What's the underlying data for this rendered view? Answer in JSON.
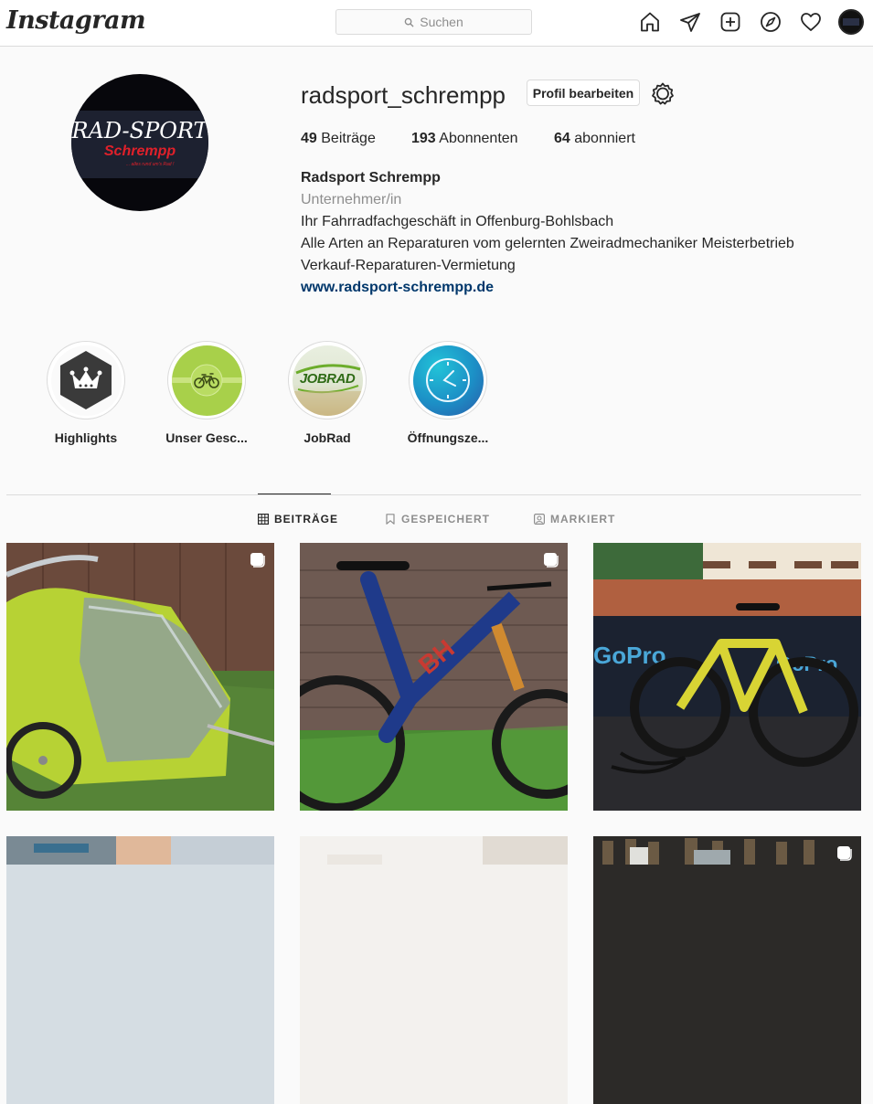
{
  "nav": {
    "logo": "Instagram",
    "search_placeholder": "Suchen",
    "icons": [
      "home-icon",
      "direct-icon",
      "new-post-icon",
      "explore-icon",
      "activity-icon",
      "profile-avatar"
    ]
  },
  "profile": {
    "username": "radsport_schrempp",
    "edit_button": "Profil bearbeiten",
    "avatar_text": {
      "line1": "RAD-SPORT",
      "line2": "Schrempp",
      "line3": "... alles rund um's Rad !"
    },
    "stats": {
      "posts_count": "49",
      "posts_label": "Beiträge",
      "followers_count": "193",
      "followers_label": "Abonnenten",
      "following_count": "64",
      "following_label": "abonniert"
    },
    "bio": {
      "name": "Radsport Schrempp",
      "category": "Unternehmer/in",
      "lines": [
        "Ihr Fahrradfachgeschäft in Offenburg-Bohlsbach",
        "Alle Arten an Reparaturen vom gelernten Zweiradmechaniker Meisterbetrieb",
        "Verkauf-Reparaturen-Vermietung"
      ],
      "website": "www.radsport-schrempp.de"
    }
  },
  "highlights": [
    {
      "label": "Highlights"
    },
    {
      "label": "Unser Gesc..."
    },
    {
      "label": "JobRad",
      "image_text": "JOBRAD"
    },
    {
      "label": "Öffnungsze..."
    }
  ],
  "tabs": [
    {
      "label": "BEITRÄGE",
      "active": true
    },
    {
      "label": "GESPEICHERT",
      "active": false
    },
    {
      "label": "MARKIERT",
      "active": false
    }
  ],
  "colors": {
    "text": "#262626",
    "muted": "#8e8e8e",
    "link": "#00376b",
    "border": "#dbdbdb",
    "background": "#fafafa",
    "highlight_green": "#a8d04a",
    "highlight_blue": "#1aa6c8"
  }
}
